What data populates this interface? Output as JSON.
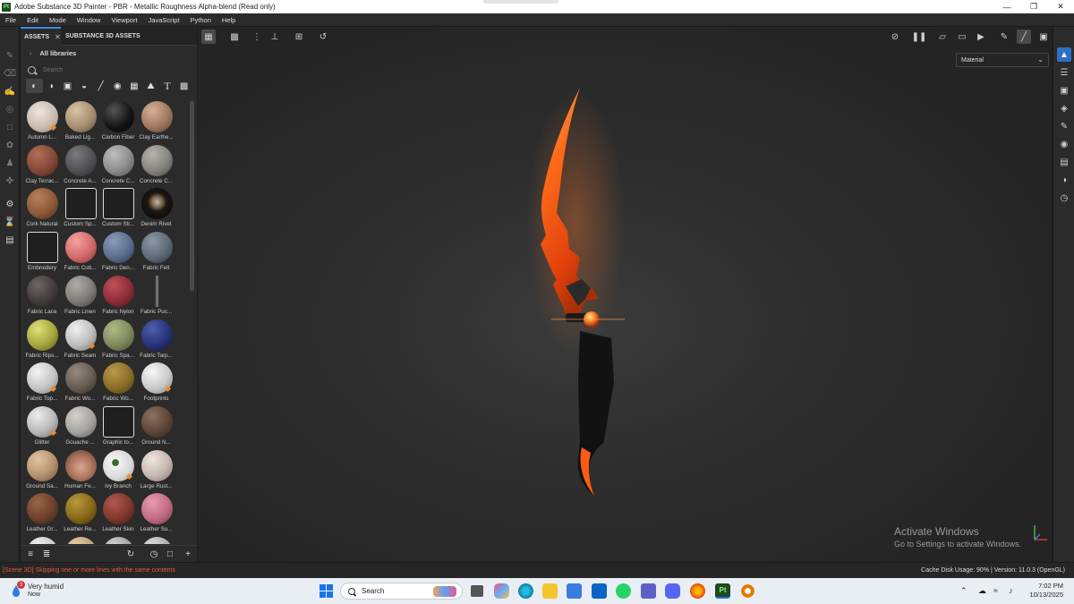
{
  "window": {
    "title": "Adobe Substance 3D Painter - PBR - Metallic Roughness Alpha-blend (Read only)",
    "app_icon": "Pt",
    "controls": [
      "minimize-icon",
      "maximize-icon",
      "close-icon"
    ]
  },
  "menu": [
    "File",
    "Edit",
    "Mode",
    "Window",
    "Viewport",
    "JavaScript",
    "Python",
    "Help"
  ],
  "assets_panel": {
    "tabs": [
      {
        "label": "ASSETS",
        "active": true
      },
      {
        "label": "SUBSTANCE 3D ASSETS",
        "active": false
      }
    ],
    "libraries_label": "All libraries",
    "search_placeholder": "Search",
    "filters": [
      "materials-icon",
      "smart-materials-icon",
      "masks-icon",
      "procedurals-icon",
      "brushes-icon",
      "particles-icon",
      "textures-icon",
      "environments-icon",
      "fonts-icon",
      "all-icon"
    ],
    "items": [
      {
        "label": "Autumn L...",
        "swatch": "radial-gradient(circle at 40% 35%,#f0e6de,#c8b8ac 60%,#8a7a70)",
        "badge": true,
        "doc": false
      },
      {
        "label": "Baked Lig...",
        "swatch": "radial-gradient(circle at 35% 30%,#d9c3a6,#a88e70 55%,#5e4b38)",
        "badge": false,
        "doc": false
      },
      {
        "label": "Carbon Fiber",
        "swatch": "radial-gradient(circle at 35% 30%,#555,#151515 55%,#050505)",
        "badge": false,
        "doc": false
      },
      {
        "label": "Clay Earthe...",
        "swatch": "radial-gradient(circle at 35% 30%,#d6b197,#a17860 55%,#5b3d2b)",
        "badge": false,
        "doc": false
      },
      {
        "label": "Clay Terrac...",
        "swatch": "radial-gradient(circle at 35% 30%,#b0705a,#864836 55%,#47221a)",
        "badge": false,
        "doc": false
      },
      {
        "label": "Concrete A...",
        "swatch": "radial-gradient(circle at 35% 30%,#7a7a7e,#515155 55%,#2a2a2c)",
        "badge": false,
        "doc": false
      },
      {
        "label": "Concrete C...",
        "swatch": "radial-gradient(circle at 35% 30%,#bdbdbd,#8c8c8c 55%,#4a4a4a)",
        "badge": false,
        "doc": false
      },
      {
        "label": "Concrete C...",
        "swatch": "radial-gradient(circle at 35% 30%,#b5b3ad,#85837d 55%,#46443f)",
        "badge": false,
        "doc": false
      },
      {
        "label": "Cork Natural",
        "swatch": "radial-gradient(circle at 35% 30%,#b8805a,#8c5a3a 55%,#4a2c1a)",
        "badge": false,
        "doc": false
      },
      {
        "label": "Custom Sp...",
        "swatch": "",
        "badge": false,
        "doc": true
      },
      {
        "label": "Custom Sti...",
        "swatch": "",
        "badge": false,
        "doc": true
      },
      {
        "label": "Denim Rivet",
        "swatch": "radial-gradient(circle at 50% 45%,#c9b9a0 0%,#6e5c48 25%,#201810 40%,#0e0e0e 70%)",
        "badge": false,
        "doc": false
      },
      {
        "label": "Embroidery",
        "swatch": "",
        "badge": false,
        "doc": true
      },
      {
        "label": "Fabric Cott...",
        "swatch": "radial-gradient(circle at 35% 30%,#f5a0a0,#d36a6a 55%,#7a3232)",
        "badge": false,
        "doc": false
      },
      {
        "label": "Fabric Den...",
        "swatch": "radial-gradient(circle at 35% 30%,#8a9cb8,#5a6e8e 55%,#2a3650)",
        "badge": false,
        "doc": false
      },
      {
        "label": "Fabric Felt",
        "swatch": "radial-gradient(circle at 35% 30%,#8c98a6,#5e6a78 55%,#2e3640)",
        "badge": false,
        "doc": false
      },
      {
        "label": "Fabric Lace",
        "swatch": "radial-gradient(circle at 35% 30%,#6e6666,#433c3c 55%,#1e1a1a)",
        "badge": false,
        "doc": false
      },
      {
        "label": "Fabric Linen",
        "swatch": "radial-gradient(circle at 35% 30%,#b0aca8,#7e7a76 55%,#3e3a36)",
        "badge": false,
        "doc": false
      },
      {
        "label": "Fabric Nylon",
        "swatch": "radial-gradient(circle at 35% 30%,#c0505a,#8c2c36 55%,#48141a)",
        "badge": false,
        "doc": false
      },
      {
        "label": "Fabric Puc...",
        "swatch": "linear-gradient(90deg,transparent 44%,#555 46%,#888 50%,#555 54%,transparent 56%)",
        "badge": false,
        "doc": false
      },
      {
        "label": "Fabric Rips...",
        "swatch": "radial-gradient(circle at 35% 30%,#e0e07a,#a6a63e 55%,#56561a)",
        "badge": false,
        "doc": false
      },
      {
        "label": "Fabric Seam",
        "swatch": "radial-gradient(circle at 35% 30%,#f0f0f0,#bdbdbd 55%,#6e6e6e)",
        "badge": true,
        "doc": false
      },
      {
        "label": "Fabric Spa...",
        "swatch": "radial-gradient(circle at 35% 30%,#b0ba88,#80895c 55%,#42482c)",
        "badge": false,
        "doc": false
      },
      {
        "label": "Fabric Tarp...",
        "swatch": "radial-gradient(circle at 35% 30%,#4e5ea8,#27347a 55%,#0e143c)",
        "badge": false,
        "doc": false
      },
      {
        "label": "Fabric Top...",
        "swatch": "radial-gradient(circle at 35% 30%,#f4f4f4,#c4c4c4 55%,#7a7a7a)",
        "badge": true,
        "doc": false
      },
      {
        "label": "Fabric Wo...",
        "swatch": "radial-gradient(circle at 35% 30%,#948a80,#665c52 55%,#322a22)",
        "badge": false,
        "doc": false
      },
      {
        "label": "Fabric Wo...",
        "swatch": "radial-gradient(circle at 35% 30%,#b89a4a,#8a6e28 55%,#46360e)",
        "badge": false,
        "doc": false
      },
      {
        "label": "Footprints",
        "swatch": "radial-gradient(circle at 35% 30%,#f6f6f6,#cacaca 55%,#808080)",
        "badge": true,
        "doc": false
      },
      {
        "label": "Glitter",
        "swatch": "radial-gradient(circle at 35% 30%,#ececec,#b8b8b8 55%,#6a6a6a)",
        "badge": true,
        "doc": false
      },
      {
        "label": "Gouache ...",
        "swatch": "radial-gradient(circle at 35% 30%,#d4d0cc,#a6a29e 55%,#5c5854)",
        "badge": false,
        "doc": false
      },
      {
        "label": "Graphic to...",
        "swatch": "",
        "badge": false,
        "doc": true
      },
      {
        "label": "Ground N...",
        "swatch": "radial-gradient(circle at 35% 30%,#8a7060,#5e4638 55%,#2e2018)",
        "badge": false,
        "doc": false
      },
      {
        "label": "Ground Sa...",
        "swatch": "radial-gradient(circle at 35% 30%,#e2c4a2,#b49270 55%,#6a5038)",
        "badge": false,
        "doc": false
      },
      {
        "label": "Human Fe...",
        "swatch": "radial-gradient(circle at 50% 55%,#d8a890,#b07860 45%,#5a3828)",
        "badge": false,
        "doc": false
      },
      {
        "label": "Ivy Branch",
        "swatch": "radial-gradient(circle at 40% 40%,#3c6a2a 0%,#3c6a2a 12%,#f2f2f2 14%,#d6d6d6 60%,#8a8a8a)",
        "badge": true,
        "doc": false
      },
      {
        "label": "Large Rust...",
        "swatch": "radial-gradient(circle at 35% 30%,#f0e4e0,#c6b6b0 55%,#7e6c66)",
        "badge": false,
        "doc": false
      },
      {
        "label": "Leather Gr...",
        "swatch": "radial-gradient(circle at 35% 30%,#9a6648,#6c402a 55%,#341e12)",
        "badge": false,
        "doc": false
      },
      {
        "label": "Leather Re...",
        "swatch": "radial-gradient(circle at 35% 30%,#b89a3a,#86681a 55%,#463408)",
        "badge": false,
        "doc": false
      },
      {
        "label": "Leather Skin",
        "swatch": "radial-gradient(circle at 35% 30%,#b05a4e,#82362c 55%,#421812)",
        "badge": false,
        "doc": false
      },
      {
        "label": "Leather Su...",
        "swatch": "radial-gradient(circle at 35% 30%,#e89ab0,#c06c84 55%,#703846)",
        "badge": false,
        "doc": false
      },
      {
        "label": "",
        "swatch": "radial-gradient(circle at 35% 30%,#f2f2f2,#c8c8c8 55%,#808080)",
        "badge": false,
        "doc": false
      },
      {
        "label": "",
        "swatch": "radial-gradient(circle at 35% 30%,#e8d0a8,#bda07a 55%,#76603e)",
        "badge": false,
        "doc": false
      },
      {
        "label": "",
        "swatch": "radial-gradient(circle at 35% 30%,#d8d8d8,#9e9e9e 55%,#5a5a5a)",
        "badge": false,
        "doc": false
      },
      {
        "label": "",
        "swatch": "radial-gradient(circle at 35% 30%,#e0e0e0,#acacac 55%,#666)",
        "badge": false,
        "doc": false
      }
    ]
  },
  "viewport": {
    "display_mode": "Material",
    "watermark_title": "Activate Windows",
    "watermark_sub": "Go to Settings to activate Windows."
  },
  "status": {
    "message": "[Scene 3D] Skipping one or more lines with the same contents",
    "info": "Cache Disk Usage:   90% | Version: 11.0.3 (OpenGL)"
  },
  "taskbar": {
    "weather_title": "Very humid",
    "weather_sub": "Now",
    "weather_badge": "3",
    "search_placeholder": "Search",
    "time": "7:02 PM",
    "date": "10/13/2025"
  },
  "colors": {
    "accent": "#2f6fc4",
    "status_error": "#e25a3e",
    "blade_glow": "#ff6a1a"
  }
}
